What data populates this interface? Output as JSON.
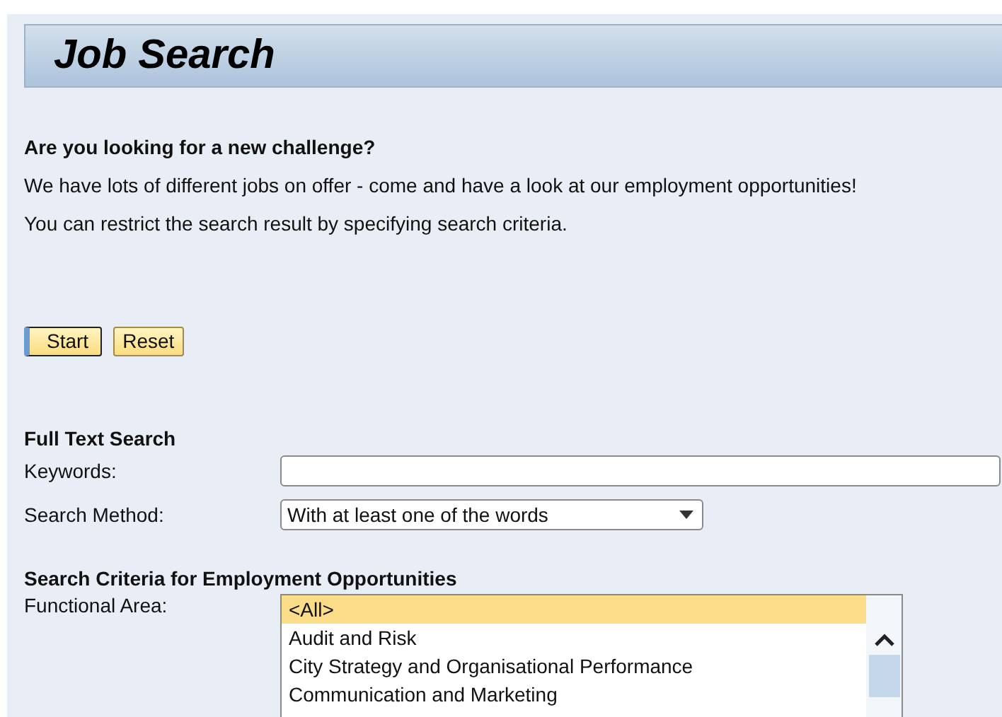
{
  "header": {
    "title": "Job Search"
  },
  "intro": {
    "heading": "Are you looking for a new challenge?",
    "lines": [
      "We have lots of different jobs on offer - come and have a look at our employment opportunities!",
      "You can restrict the search result by specifying search criteria."
    ]
  },
  "buttons": [
    {
      "label": "Start",
      "focused": true
    },
    {
      "label": "Reset",
      "focused": false
    }
  ],
  "full_text_search": {
    "heading": "Full Text Search",
    "keywords": {
      "label": "Keywords:"
    },
    "search_method": {
      "label": "Search Method:",
      "value": "With at least one of the words"
    }
  },
  "criteria": {
    "heading": "Search Criteria for Employment Opportunities",
    "functional_area": {
      "label": "Functional Area:",
      "options": [
        {
          "label": "<All>",
          "selected": true
        },
        {
          "label": "Audit and Risk",
          "selected": false
        },
        {
          "label": "City Strategy and Organisational Performance",
          "selected": false
        },
        {
          "label": "Communication and Marketing",
          "selected": false
        }
      ]
    }
  }
}
